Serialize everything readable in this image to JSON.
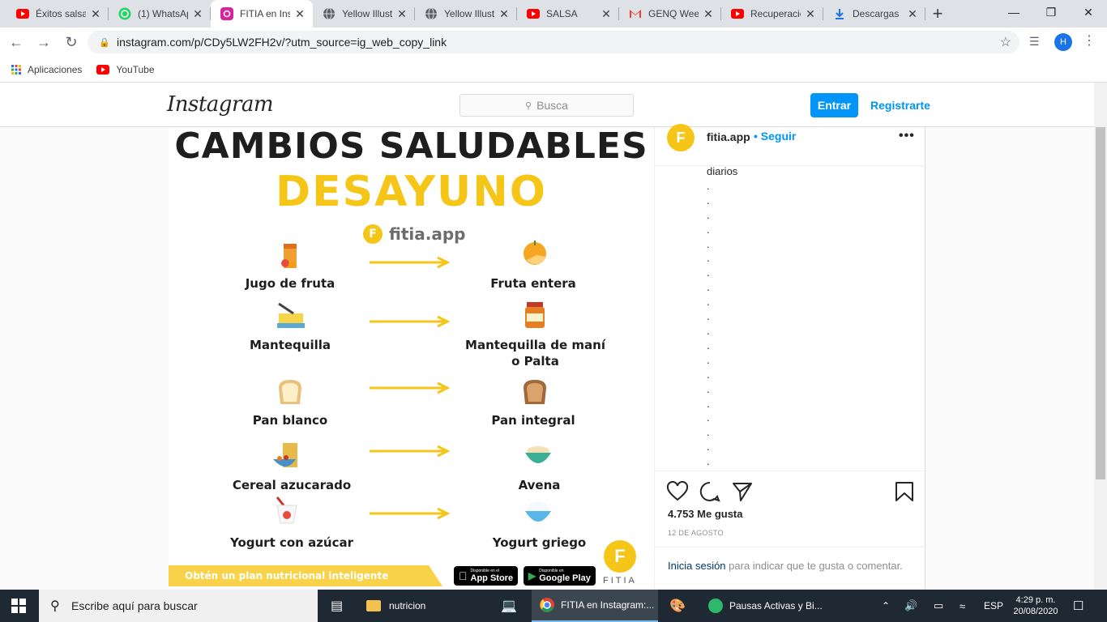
{
  "tabs": [
    {
      "title": "Éxitos salsa",
      "icon": "youtube-icon"
    },
    {
      "title": "(1) WhatsApp",
      "icon": "whatsapp-icon"
    },
    {
      "title": "FITIA en Ins",
      "icon": "instagram-icon",
      "active": true
    },
    {
      "title": "Yellow Illust",
      "icon": "globe-icon"
    },
    {
      "title": "Yellow Illust",
      "icon": "globe-icon"
    },
    {
      "title": "SALSA",
      "icon": "youtube-icon"
    },
    {
      "title": "GENQ Weel",
      "icon": "gmail-icon"
    },
    {
      "title": "Recuperació",
      "icon": "youtube-icon"
    },
    {
      "title": "Descargas",
      "icon": "download-icon"
    }
  ],
  "address": {
    "url": "instagram.com/p/CDy5LW2FH2v/?utm_source=ig_web_copy_link"
  },
  "profile_initial": "H",
  "bookmarks": {
    "apps": "Aplicaciones",
    "youtube": "YouTube"
  },
  "ig": {
    "logo": "Instagram",
    "search_placeholder": "Busca",
    "login_label": "Entrar",
    "register_label": "Registrarte"
  },
  "post": {
    "title": "CAMBIOS SALUDABLES",
    "subtitle": "DESAYUNO",
    "brand": "fitia.app",
    "items": [
      {
        "from": "Jugo de fruta",
        "to": "Fruta entera"
      },
      {
        "from": "Mantequilla",
        "to": "Mantequilla de maní o Palta"
      },
      {
        "from": "Pan blanco",
        "to": "Pan integral"
      },
      {
        "from": "Cereal azucarado",
        "to": "Avena"
      },
      {
        "from": "Yogurt con azúcar",
        "to": "Yogurt griego"
      }
    ],
    "banner": "Obtén un plan nutricional inteligente",
    "appstore_small": "Disponible en el",
    "appstore": "App Store",
    "googleplay_small": "Disponible en",
    "googleplay": "Google Play",
    "fitia_logo_text": "FITIA"
  },
  "side": {
    "username": "fitia.app",
    "follow": "• Seguir",
    "caption_first": "diarios",
    "caption_dots": 20,
    "likes": "4.753 Me gusta",
    "date": "12 DE AGOSTO",
    "login_link": "Inicia sesión",
    "login_rest": " para indicar que te gusta o comentar."
  },
  "taskbar": {
    "search_placeholder": "Escribe aquí para buscar",
    "apps": [
      {
        "label": "nutricion"
      },
      {
        "label": "FITIA en Instagram:..."
      },
      {
        "label": "Pausas Activas y Bi..."
      }
    ],
    "lang": "ESP",
    "time": "4:29 p. m.",
    "date": "20/08/2020"
  }
}
